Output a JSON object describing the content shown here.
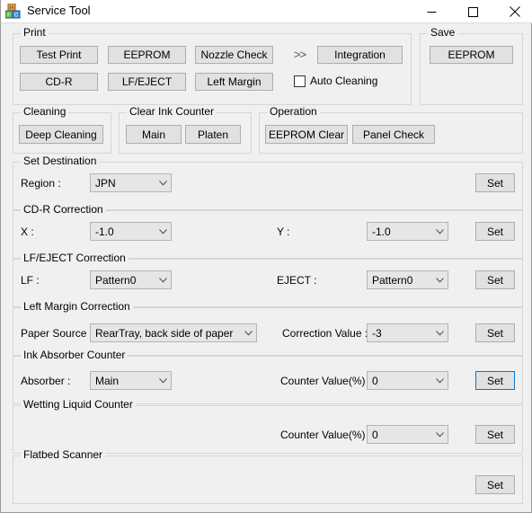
{
  "window": {
    "title": "Service Tool",
    "icon": "app-blocks-icon",
    "controls": {
      "minimize": "minimize-icon",
      "maximize": "maximize-icon",
      "close": "close-icon"
    }
  },
  "colors": {
    "window_bg": "#f0f0f0",
    "titlebar_bg": "#ffffff",
    "button_face": "#e1e1e1",
    "button_border": "#adadad",
    "combo_face": "#e6e6e6",
    "group_border": "#d6d6d6",
    "focus_accent": "#0078d7",
    "text": "#000000"
  },
  "groups": {
    "print": {
      "label": "Print",
      "buttons": [
        {
          "label": "Test Print"
        },
        {
          "label": "EEPROM"
        },
        {
          "label": "Nozzle Check"
        },
        {
          "label": "CD-R"
        },
        {
          "label": "LF/EJECT"
        },
        {
          "label": "Left Margin"
        }
      ],
      "chevron": ">>",
      "integration_button": "Integration",
      "auto_cleaning_checkbox": {
        "label": "Auto Cleaning",
        "checked": false
      }
    },
    "save": {
      "label": "Save",
      "button": "EEPROM"
    },
    "cleaning": {
      "label": "Cleaning",
      "button": "Deep Cleaning"
    },
    "clear_ink_counter": {
      "label": "Clear Ink Counter",
      "buttons": [
        {
          "label": "Main"
        },
        {
          "label": "Platen"
        }
      ]
    },
    "operation": {
      "label": "Operation",
      "buttons": [
        {
          "label": "EEPROM Clear"
        },
        {
          "label": "Panel Check"
        }
      ]
    },
    "set_destination": {
      "label": "Set Destination",
      "region_label": "Region :",
      "region_value": "JPN",
      "set_button": "Set"
    },
    "cdr_correction": {
      "label": "CD-R Correction",
      "x_label": "X :",
      "x_value": "-1.0",
      "y_label": "Y :",
      "y_value": "-1.0",
      "set_button": "Set"
    },
    "lfeject_correction": {
      "label": "LF/EJECT Correction",
      "lf_label": "LF :",
      "lf_value": "Pattern0",
      "eject_label": "EJECT :",
      "eject_value": "Pattern0",
      "set_button": "Set"
    },
    "left_margin_correction": {
      "label": "Left Margin Correction",
      "paper_source_label": "Paper Source :",
      "paper_source_value": "RearTray, back side of paper",
      "correction_value_label": "Correction Value :",
      "correction_value": "-3",
      "set_button": "Set"
    },
    "ink_absorber_counter": {
      "label": "Ink Absorber Counter",
      "absorber_label": "Absorber :",
      "absorber_value": "Main",
      "counter_label": "Counter Value(%) :",
      "counter_value": "0",
      "set_button": "Set",
      "set_button_focused": true
    },
    "wetting_liquid_counter": {
      "label": "Wetting Liquid Counter",
      "counter_label": "Counter Value(%) :",
      "counter_value": "0",
      "set_button": "Set"
    },
    "flatbed_scanner": {
      "label": "Flatbed Scanner",
      "set_button": "Set"
    }
  }
}
